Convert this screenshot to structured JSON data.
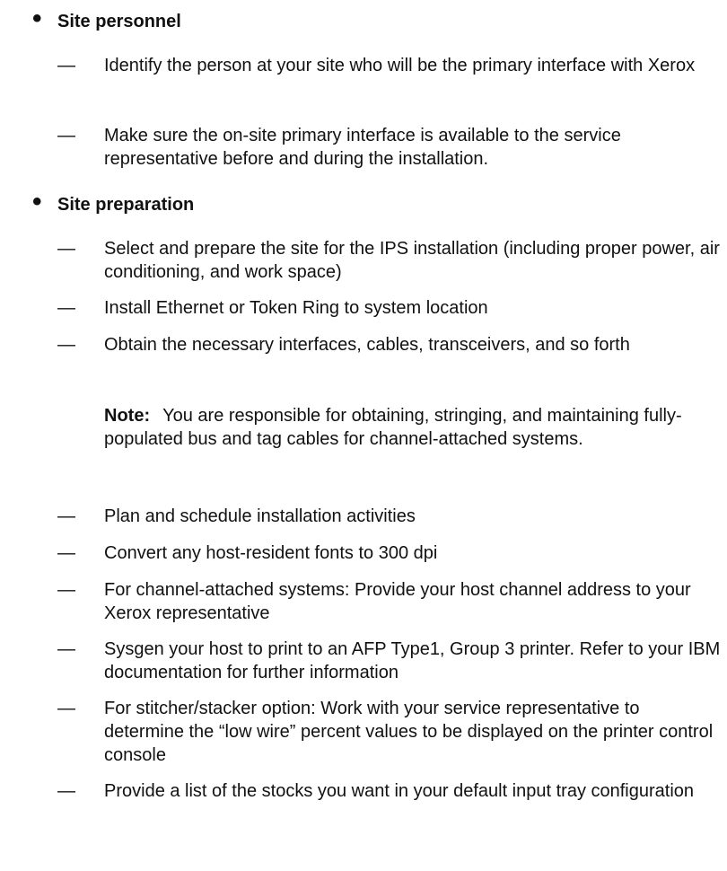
{
  "sections": [
    {
      "bullet": "•",
      "title": "Site personnel",
      "items": [
        {
          "dash": "—",
          "text": "Identify the person at your site who will be the primary interface with Xerox"
        },
        {
          "dash": "—",
          "text": "Make sure the on-site primary interface is available to the service representative before and during the installation."
        }
      ]
    },
    {
      "bullet": "•",
      "title": "Site preparation",
      "items": [
        {
          "dash": "—",
          "text": "Select and prepare the site for the IPS installation (including proper power, air conditioning, and work space)"
        },
        {
          "dash": "—",
          "text": "Install Ethernet or Token Ring to system location"
        },
        {
          "dash": "—",
          "text": "Obtain the necessary interfaces, cables, transceivers, and so forth"
        },
        {
          "dash": "—",
          "text": "Plan and schedule installation activities"
        },
        {
          "dash": "—",
          "text": "Convert any host-resident fonts to 300 dpi"
        },
        {
          "dash": "—",
          "text": "For channel-attached systems: Provide your host channel address to your Xerox representative"
        },
        {
          "dash": "—",
          "text": "Sysgen your host to print to an AFP Type1, Group 3 printer. Refer to your IBM documentation for further information"
        },
        {
          "dash": "—",
          "text": "For stitcher/stacker option: Work with your service representative to determine the “low wire” percent values to be displayed on the printer control console"
        },
        {
          "dash": "—",
          "text": "Provide a list of the stocks you want in your default input tray configuration"
        }
      ],
      "note": {
        "label": "Note:",
        "text": "You are responsible for obtaining, stringing, and maintaining fully-populated bus and tag cables for channel-attached systems."
      }
    }
  ]
}
